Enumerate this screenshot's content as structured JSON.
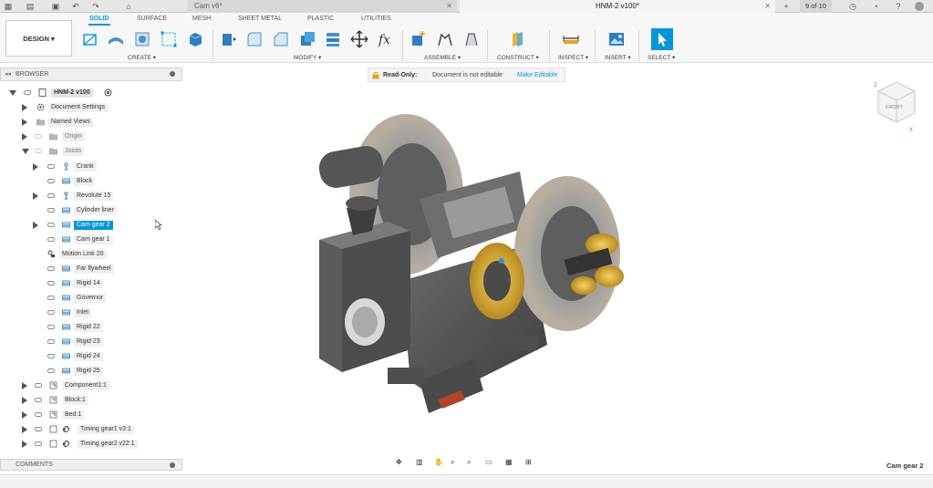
{
  "titlebar": {
    "tabs": [
      {
        "label": "Cam v6*",
        "active": false
      },
      {
        "label": "HNM-2 v100*",
        "active": true
      }
    ],
    "job_status": "9 of 10"
  },
  "toolbar": {
    "workspace_label": "DESIGN ▾",
    "workspace_tabs": [
      "SOLID",
      "SURFACE",
      "MESH",
      "SHEET METAL",
      "PLASTIC",
      "UTILITIES"
    ],
    "active_tab": "SOLID",
    "groups": [
      "CREATE ▾",
      "MODIFY ▾",
      "ASSEMBLE ▾",
      "CONSTRUCT ▾",
      "INSPECT ▾",
      "INSERT ▾",
      "SELECT ▾"
    ],
    "accent": "#0696d7"
  },
  "browser": {
    "title": "BROWSER",
    "root": "HNM-2 v100",
    "items": [
      {
        "label": "Document Settings",
        "icon": "gear-icon"
      },
      {
        "label": "Named Views",
        "icon": "folder-icon"
      },
      {
        "label": "Origin",
        "icon": "folder-icon"
      },
      {
        "label": "Joints",
        "icon": "folder-icon"
      },
      {
        "label": "Crank",
        "icon": "joint-icon"
      },
      {
        "label": "Block",
        "icon": "rigid-joint-icon"
      },
      {
        "label": "Revolute 15",
        "icon": "joint-icon"
      },
      {
        "label": "Cylinder liner",
        "icon": "rigid-joint-icon"
      },
      {
        "label": "Cam gear 2",
        "icon": "rigid-joint-icon"
      },
      {
        "label": "Cam gear 1",
        "icon": "rigid-joint-icon"
      },
      {
        "label": "Motion Link 20",
        "icon": "motion-link-icon"
      },
      {
        "label": "Far flywheel",
        "icon": "rigid-joint-icon"
      },
      {
        "label": "Rigid 14",
        "icon": "rigid-joint-icon"
      },
      {
        "label": "Governor",
        "icon": "rigid-joint-icon"
      },
      {
        "label": "Inlet",
        "icon": "rigid-joint-icon"
      },
      {
        "label": "Rigid 22",
        "icon": "rigid-joint-icon"
      },
      {
        "label": "Rigid 23",
        "icon": "rigid-joint-icon"
      },
      {
        "label": "Rigid 24",
        "icon": "rigid-joint-icon"
      },
      {
        "label": "Rigid 25",
        "icon": "rigid-joint-icon"
      },
      {
        "label": "Component1:1",
        "icon": "component-icon"
      },
      {
        "label": "Block:1",
        "icon": "component-icon"
      },
      {
        "label": "Bed:1",
        "icon": "component-icon"
      },
      {
        "label": "Timing gear1 v3:1",
        "icon": "linked-component-icon"
      },
      {
        "label": "Timing gear2 v22:1",
        "icon": "linked-component-icon"
      }
    ]
  },
  "comments": {
    "title": "COMMENTS"
  },
  "readonly_banner": {
    "title": "Read-Only:",
    "message": "Document is not editable",
    "action": "Make Editable"
  },
  "viewcube": {
    "face": "FRONT",
    "axis_z": "Z",
    "axis_x": "X"
  },
  "status": {
    "active_component": "Cam gear 2"
  }
}
